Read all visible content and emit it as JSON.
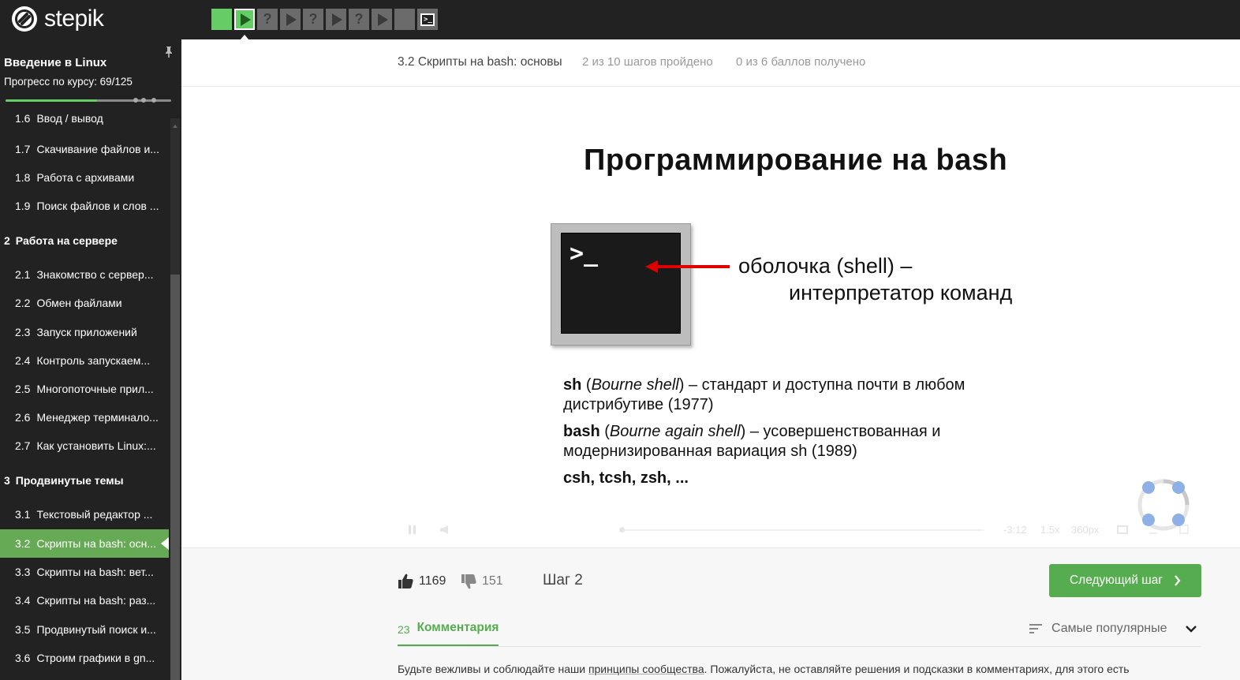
{
  "brand": {
    "name": "stepik"
  },
  "step_nav": {
    "items": [
      {
        "type": "passed",
        "icon": ""
      },
      {
        "type": "current",
        "icon": "play-icon"
      },
      {
        "type": "pending",
        "icon": "?"
      },
      {
        "type": "pending",
        "icon": "play-icon"
      },
      {
        "type": "pending",
        "icon": "?"
      },
      {
        "type": "pending",
        "icon": "play-icon"
      },
      {
        "type": "pending",
        "icon": "?"
      },
      {
        "type": "pending",
        "icon": "play-icon"
      },
      {
        "type": "pending",
        "icon": ""
      },
      {
        "type": "pending",
        "icon": "terminal-icon"
      }
    ]
  },
  "sidebar": {
    "course_title": "Введение в Linux",
    "progress_text": "Прогресс по курсу:  69/125",
    "progress": {
      "value": 69,
      "total": 125
    },
    "sections": [
      {
        "num": "2",
        "title": "Работа на сервере"
      },
      {
        "num": "3",
        "title": "Продвинутые темы"
      }
    ],
    "lessons_s1": [
      {
        "num": "1.6",
        "title": "Ввод / вывод"
      },
      {
        "num": "1.7",
        "title": "Скачивание файлов и..."
      },
      {
        "num": "1.8",
        "title": "Работа с архивами"
      },
      {
        "num": "1.9",
        "title": "Поиск файлов и слов ..."
      }
    ],
    "lessons_s2": [
      {
        "num": "2.1",
        "title": "Знакомство с сервер..."
      },
      {
        "num": "2.2",
        "title": "Обмен файлами"
      },
      {
        "num": "2.3",
        "title": "Запуск приложений"
      },
      {
        "num": "2.4",
        "title": "Контроль запускаем..."
      },
      {
        "num": "2.5",
        "title": "Многопоточные прил..."
      },
      {
        "num": "2.6",
        "title": "Менеджер терминало..."
      },
      {
        "num": "2.7",
        "title": "Как установить Linux:..."
      }
    ],
    "lessons_s3": [
      {
        "num": "3.1",
        "title": "Текстовый редактор ..."
      },
      {
        "num": "3.2",
        "title": "Скрипты на bash: осн..."
      },
      {
        "num": "3.3",
        "title": "Скрипты на bash: вет..."
      },
      {
        "num": "3.4",
        "title": "Скрипты на bash: раз..."
      },
      {
        "num": "3.5",
        "title": "Продвинутый поиск и..."
      },
      {
        "num": "3.6",
        "title": "Строим графики в gn..."
      }
    ]
  },
  "lesson_header": {
    "title": "3.2 Скрипты на bash: основы",
    "steps_passed": "2 из 10 шагов пройдено",
    "score": "0 из 6 баллов  получено"
  },
  "slide": {
    "title": "Программирование на bash",
    "prompt": ">_",
    "shell_line1": "оболочка (shell) –",
    "shell_line2": "интерпретатор команд",
    "p1_bold": "sh",
    "p1_italic": "Bourne shell",
    "p1_rest": "– стандарт и доступна почти в любом дистрибутиве (1977)",
    "p2_bold": "bash",
    "p2_italic": "Bourne again shell",
    "p2_rest": "– усовершенствованная и модернизированная вариация sh (1989)",
    "p3": "csh, tcsh, zsh, ..."
  },
  "player": {
    "time": "-3:12",
    "speed": "1.5x",
    "quality": "360px",
    "position": 0.0
  },
  "bottom": {
    "likes": "1169",
    "dislikes": "151",
    "step_label": "Шаг 2",
    "next_button": "Следующий шаг",
    "comments_count": "23",
    "comments_label": "Комментария",
    "sort_label": "Самые популярные",
    "rules_before": "Будьте вежливы и соблюдайте наши ",
    "rules_link": "принципы сообщества",
    "rules_after": ". Пожалуйста, не оставляйте решения и подсказки в комментариях, для этого есть"
  },
  "colors": {
    "accent_green": "#56ad4f",
    "step_green": "#66cc66",
    "dark": "#222222"
  }
}
